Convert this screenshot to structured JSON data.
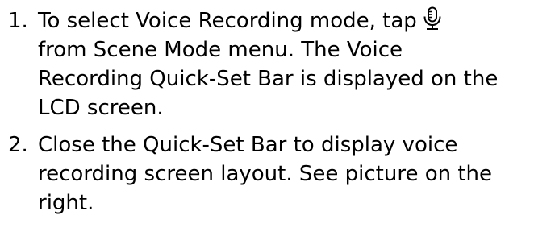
{
  "instructions": {
    "steps": [
      {
        "number": "1.",
        "lines": [
          "To select Voice Recording mode, tap",
          "from Scene Mode menu. The Voice",
          "Recording Quick-Set Bar is displayed on the",
          "LCD screen."
        ],
        "inline_icon": "microphone-icon"
      },
      {
        "number": "2.",
        "lines": [
          "Close the Quick-Set Bar to display voice",
          "recording screen layout. See picture on the",
          "right."
        ]
      }
    ]
  }
}
